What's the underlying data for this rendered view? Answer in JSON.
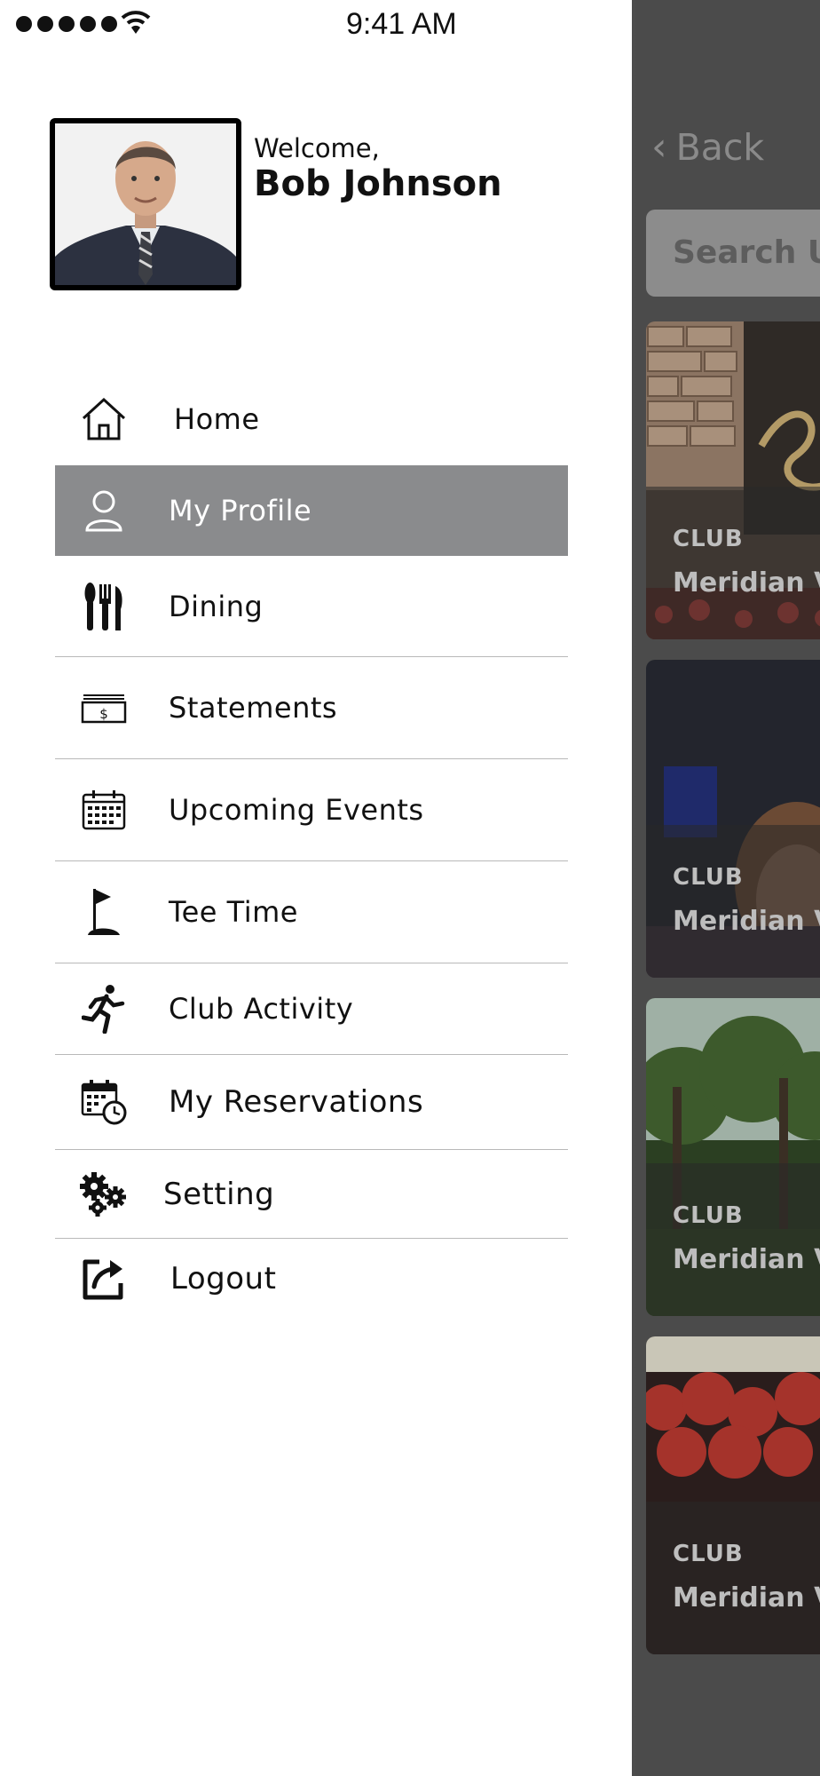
{
  "status_bar": {
    "time": "9:41 AM",
    "signal_bars": 5
  },
  "user": {
    "welcome": "Welcome,",
    "name": "Bob Johnson"
  },
  "menu": [
    {
      "label": "Home",
      "icon": "home-icon",
      "active": false
    },
    {
      "label": "My Profile",
      "icon": "user-icon",
      "active": true
    },
    {
      "label": "Dining",
      "icon": "fork-knife-icon",
      "active": false
    },
    {
      "label": "Statements",
      "icon": "money-bill-icon",
      "active": false
    },
    {
      "label": "Upcoming Events",
      "icon": "calendar-icon",
      "active": false
    },
    {
      "label": "Tee Time",
      "icon": "golf-flag-icon",
      "active": false
    },
    {
      "label": "Club Activity",
      "icon": "runner-icon",
      "active": false
    },
    {
      "label": "My Reservations",
      "icon": "calendar-clock-icon",
      "active": false
    },
    {
      "label": "Setting",
      "icon": "gears-icon",
      "active": false
    },
    {
      "label": "Logout",
      "icon": "logout-icon",
      "active": false
    }
  ],
  "background_app": {
    "back_label": "Back",
    "search_placeholder": "Search Up",
    "cards": [
      {
        "tag": "CLUB",
        "name": "Meridian Va"
      },
      {
        "tag": "CLUB",
        "name": "Meridian V"
      },
      {
        "tag": "CLUB",
        "name": "Meridian Va"
      },
      {
        "tag": "CLUB",
        "name": "Meridian V"
      }
    ]
  },
  "colors": {
    "active_item": "#8a8b8d",
    "divider": "#b9b9b9",
    "background_app": "#4b4b4b"
  }
}
